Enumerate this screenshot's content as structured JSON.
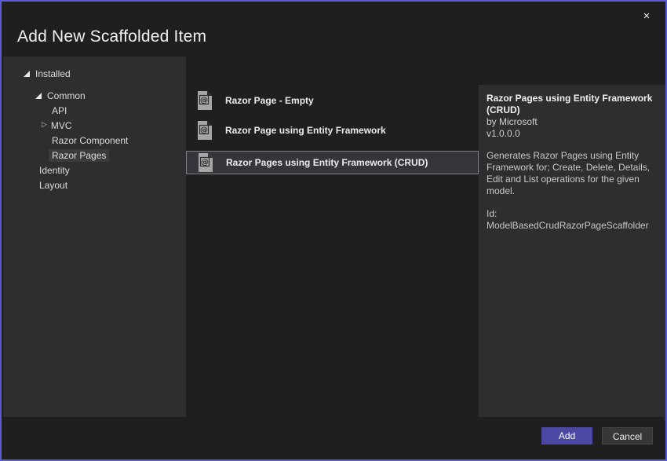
{
  "window": {
    "title": "Add New Scaffolded Item",
    "close_icon": "×"
  },
  "tree": {
    "items": [
      {
        "label": "Installed",
        "level": 0,
        "expander": "expanded",
        "selected": false
      },
      {
        "label": "Common",
        "level": 1,
        "expander": "expanded",
        "selected": false
      },
      {
        "label": "API",
        "level": 2,
        "expander": "none",
        "selected": false
      },
      {
        "label": "MVC",
        "level": 2,
        "expander": "collapsed",
        "selected": false
      },
      {
        "label": "Razor Component",
        "level": 2,
        "expander": "none",
        "selected": false
      },
      {
        "label": "Razor Pages",
        "level": 2,
        "expander": "none",
        "selected": true
      },
      {
        "label": "Identity",
        "level": 1,
        "expander": "none",
        "selected": false
      },
      {
        "label": "Layout",
        "level": 1,
        "expander": "none",
        "selected": false
      }
    ],
    "collapsed_glyph": "▷"
  },
  "template_list": {
    "items": [
      {
        "label": "Razor Page - Empty",
        "icon": "razor-page-document-icon",
        "selected": false
      },
      {
        "label": "Razor Page using Entity Framework",
        "icon": "razor-page-document-icon",
        "selected": false
      },
      {
        "label": "Razor Pages using Entity Framework (CRUD)",
        "icon": "razor-page-document-icon",
        "selected": true
      }
    ],
    "icon_glyph": "@"
  },
  "details": {
    "title": "Razor Pages using Entity Framework (CRUD)",
    "author": "by Microsoft",
    "version": "v1.0.0.0",
    "description": "Generates Razor Pages using Entity Framework for; Create, Delete, Details, Edit and List operations for the given model.",
    "id": "Id: ModelBasedCrudRazorPageScaffolder"
  },
  "footer": {
    "add_label": "Add",
    "cancel_label": "Cancel"
  },
  "colors": {
    "dialog_border": "#5B5BD6",
    "dialog_bg": "#1F1F1F",
    "panel_bg": "#2E2E2E",
    "accent_button_bg": "#4C49A5",
    "cancel_button_bg": "#373737",
    "selected_row_bg": "#35353B",
    "selected_row_border": "#7F7F7F"
  }
}
